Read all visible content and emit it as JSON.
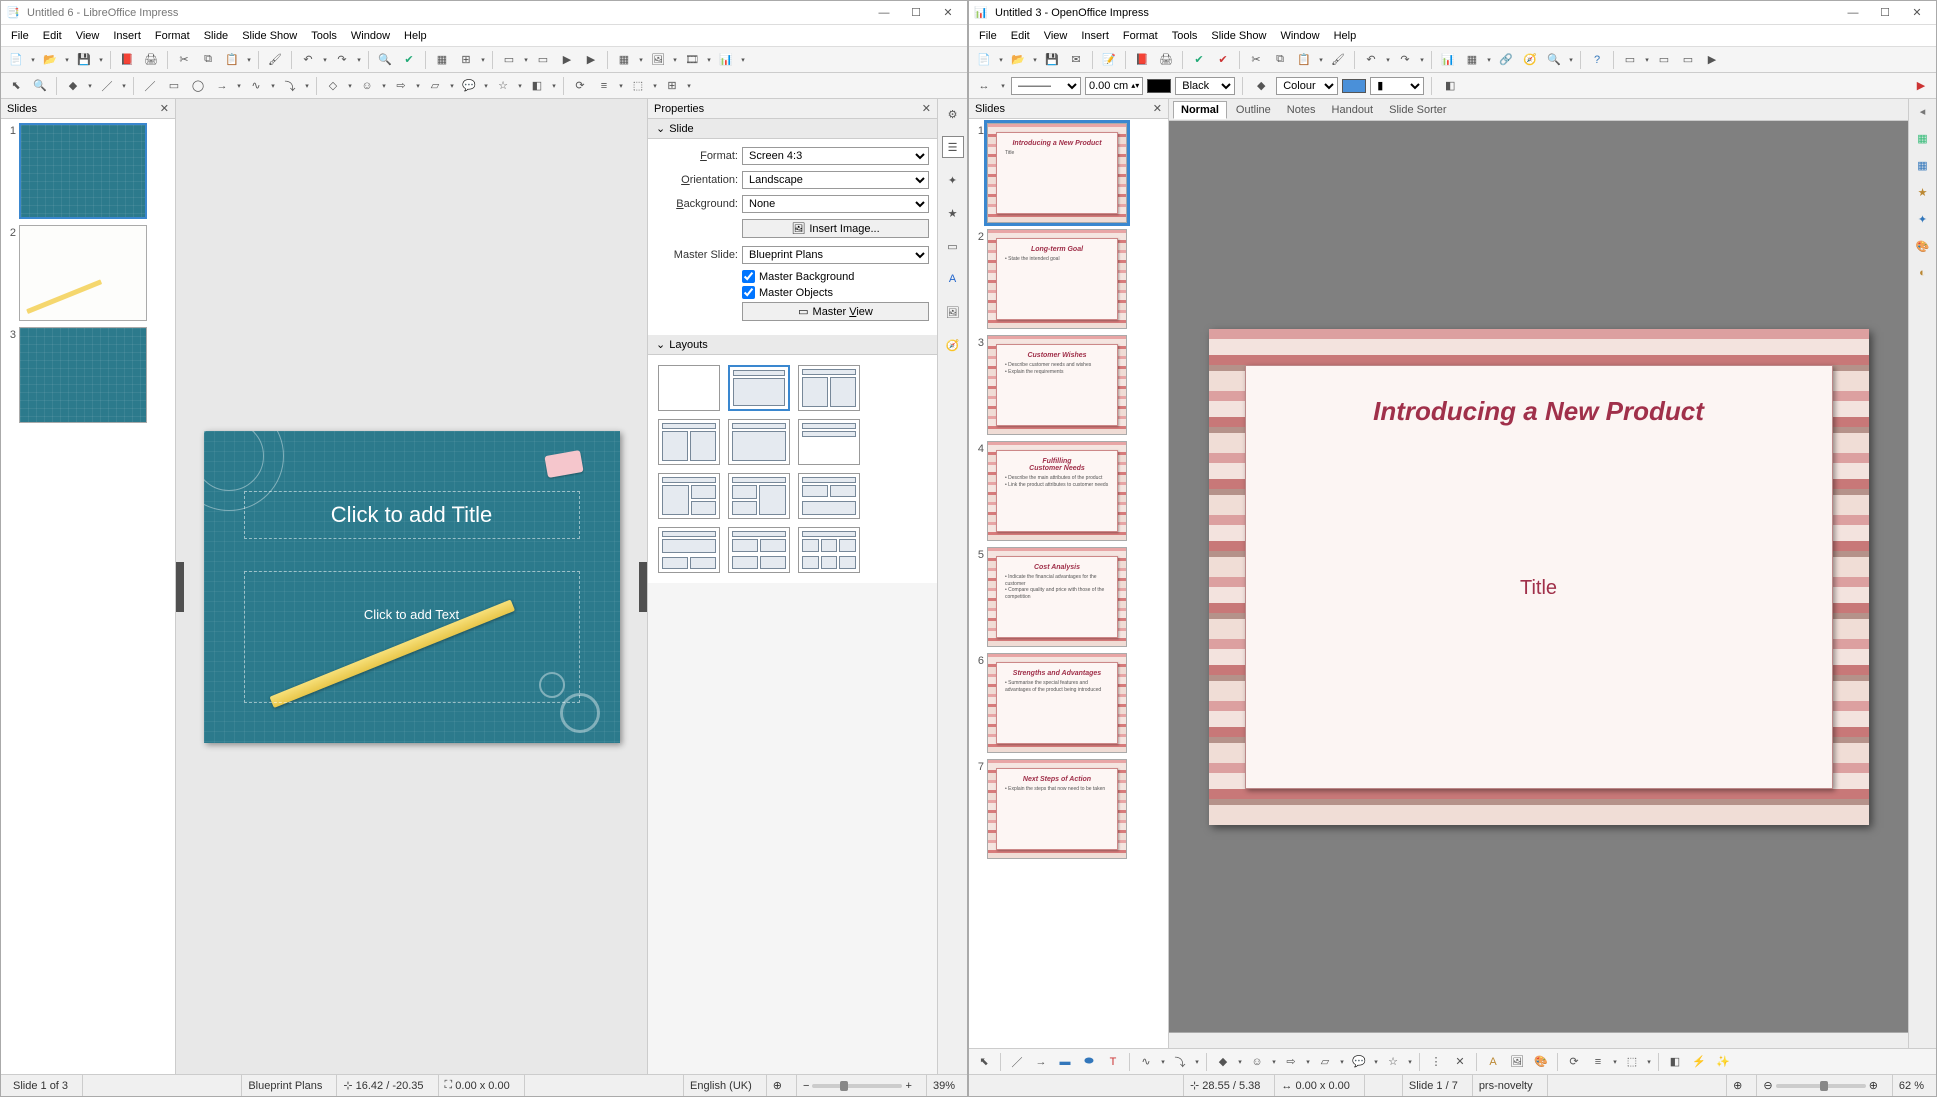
{
  "left": {
    "title": "Untitled 6 - LibreOffice Impress",
    "menu": [
      "File",
      "Edit",
      "View",
      "Insert",
      "Format",
      "Slide",
      "Slide Show",
      "Tools",
      "Window",
      "Help"
    ],
    "slides_panel_title": "Slides",
    "slide_count": 3,
    "main_slide": {
      "title_placeholder": "Click to add Title",
      "text_placeholder": "Click to add Text"
    },
    "properties": {
      "header": "Properties",
      "slide_section": "Slide",
      "format_label": "Format:",
      "format_value": "Screen 4:3",
      "orientation_label": "Orientation:",
      "orientation_value": "Landscape",
      "background_label": "Background:",
      "background_value": "None",
      "insert_image_btn": "Insert Image...",
      "master_slide_label": "Master Slide:",
      "master_slide_value": "Blueprint Plans",
      "cb_master_bg": "Master Background",
      "cb_master_obj": "Master Objects",
      "master_view_btn": "Master View",
      "layouts_section": "Layouts"
    },
    "status": {
      "slide_pos": "Slide 1 of 3",
      "template": "Blueprint Plans",
      "coords": "16.42 / -20.35",
      "size": "0.00 x 0.00",
      "lang": "English (UK)",
      "zoom": "39%"
    }
  },
  "right": {
    "title": "Untitled 3 - OpenOffice Impress",
    "menu": [
      "File",
      "Edit",
      "View",
      "Insert",
      "Format",
      "Tools",
      "Slide Show",
      "Window",
      "Help"
    ],
    "toolbar2": {
      "size_field": "0.00 cm",
      "colour_black": "Black",
      "fill_label": "Colour",
      "arrow_label": "—"
    },
    "slides_panel_title": "Slides",
    "view_tabs": [
      "Normal",
      "Outline",
      "Notes",
      "Handout",
      "Slide Sorter"
    ],
    "thumbs": [
      {
        "n": 1,
        "title": "Introducing a New Product",
        "body": "Title"
      },
      {
        "n": 2,
        "title": "Long-term Goal",
        "body": "• State the intended goal"
      },
      {
        "n": 3,
        "title": "Customer Wishes",
        "body": "• Describe customer needs and wishes\n• Explain the requirements"
      },
      {
        "n": 4,
        "title": "Fulfilling\nCustomer Needs",
        "body": "• Describe the main attributes of the product\n• Link the product attributes to customer needs"
      },
      {
        "n": 5,
        "title": "Cost Analysis",
        "body": "• Indicate the financial advantages for the customer\n• Compare quality and price with those of the competition"
      },
      {
        "n": 6,
        "title": "Strengths and Advantages",
        "body": "• Summarise the special features and advantages of the product being introduced"
      },
      {
        "n": 7,
        "title": "Next Steps of Action",
        "body": "• Explain the steps that now need to be taken"
      }
    ],
    "main_slide": {
      "title": "Introducing a New Product",
      "subtitle": "Title"
    },
    "status": {
      "coords": "28.55 / 5.38",
      "size": "0.00 x 0.00",
      "slide_pos": "Slide 1 / 7",
      "template": "prs-novelty",
      "zoom": "62 %"
    }
  }
}
